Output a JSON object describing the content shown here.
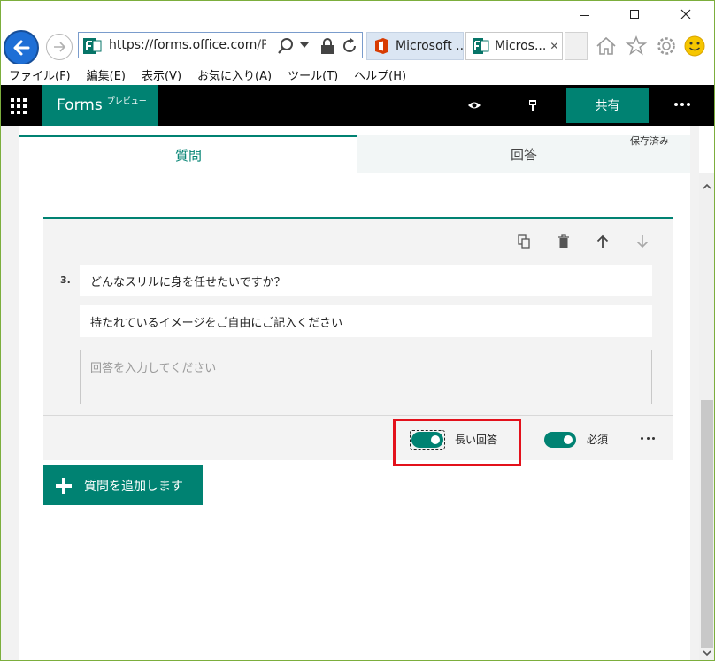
{
  "browser": {
    "address_url_main": "https://forms.",
    "address_url_domain": "office.com",
    "address_url_rest": "/Pa",
    "tabs": [
      {
        "label": "Microsoft ..."
      },
      {
        "label": "Micros..."
      }
    ],
    "tab_close_glyph": "✕"
  },
  "menubar": {
    "items": [
      {
        "label": "ファイル(F)"
      },
      {
        "label": "編集(E)"
      },
      {
        "label": "表示(V)"
      },
      {
        "label": "お気に入り(A)"
      },
      {
        "label": "ツール(T)"
      },
      {
        "label": "ヘルプ(H)"
      }
    ]
  },
  "forms_header": {
    "brand": "Forms",
    "brand_tag": "プレビュー",
    "share_label": "共有"
  },
  "editor": {
    "saved_status": "保存済み",
    "tabs": {
      "question": "質問",
      "answers": "回答"
    }
  },
  "question": {
    "number": "3.",
    "title": "どんなスリルに身を任せたいですか？",
    "subtitle": "持たれているイメージをご自由にご記入ください",
    "answer_placeholder": "回答を入力してください",
    "long_answer_label": "長い回答",
    "required_label": "必須",
    "long_answer_on": true,
    "required_on": true
  },
  "add_question_label": "質問を追加します",
  "colors": {
    "accent": "#008272",
    "highlight": "#e3111b",
    "header_bg": "#000000"
  },
  "icons": {
    "back": "back-arrow-icon",
    "forward": "forward-arrow-icon",
    "home": "home-icon",
    "favorites": "star-icon",
    "settings": "gear-icon",
    "feedback": "smiley-icon",
    "preview": "eye-icon",
    "theme": "paint-brush-icon",
    "copy": "copy-icon",
    "delete": "trash-icon",
    "move_up": "arrow-up-icon",
    "move_down": "arrow-down-icon"
  }
}
